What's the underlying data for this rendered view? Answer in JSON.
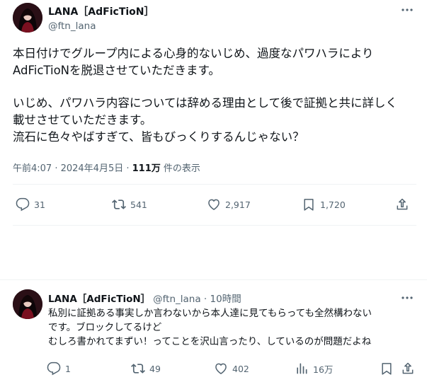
{
  "tweet": {
    "author_name": "LANA［AdFicTioN］",
    "author_handle": "@ftn_lana",
    "text_lines": [
      "本日付けでグループ内による心身的ないじめ、過度なパワハラにより",
      "AdFicTioNを脱退させていただきます。",
      "いじめ、パワハラ内容については辞める理由として後で証拠と共に詳しく",
      "載せさせていただきます。",
      "流石に色々やばすぎて、皆もびっくりするんじゃない？"
    ],
    "timestamp": "午前4:07 · 2024年4月5日 · ",
    "views_count": "111万",
    "views_suffix": " 件の表示",
    "replies": "31",
    "reposts": "541",
    "likes": "2,917",
    "bookmarks": "1,720",
    "icons": [
      "more-icon",
      "reply-icon",
      "repost-icon",
      "like-icon",
      "bookmark-icon",
      "share-icon"
    ]
  },
  "reply": {
    "author_name": "LANA［AdFicTioN］",
    "author_handle": "@ftn_lana",
    "time": "10時間",
    "text_lines": [
      "私別に証拠ある事実しか言わないから本人達に見てもらっても全然構わない",
      "です。ブロックしてるけど",
      "むしろ書かれてまずい！ってことを沢山言ったり、しているのが問題だよね"
    ],
    "replies": "1",
    "reposts": "49",
    "likes": "402",
    "views": "16万",
    "icons": [
      "reply-icon",
      "repost-icon",
      "like-icon",
      "views-icon",
      "bookmark-icon",
      "share-icon"
    ]
  },
  "colors": {
    "text": "#0f1419",
    "secondary": "#536471",
    "divider": "#eff3f4"
  }
}
